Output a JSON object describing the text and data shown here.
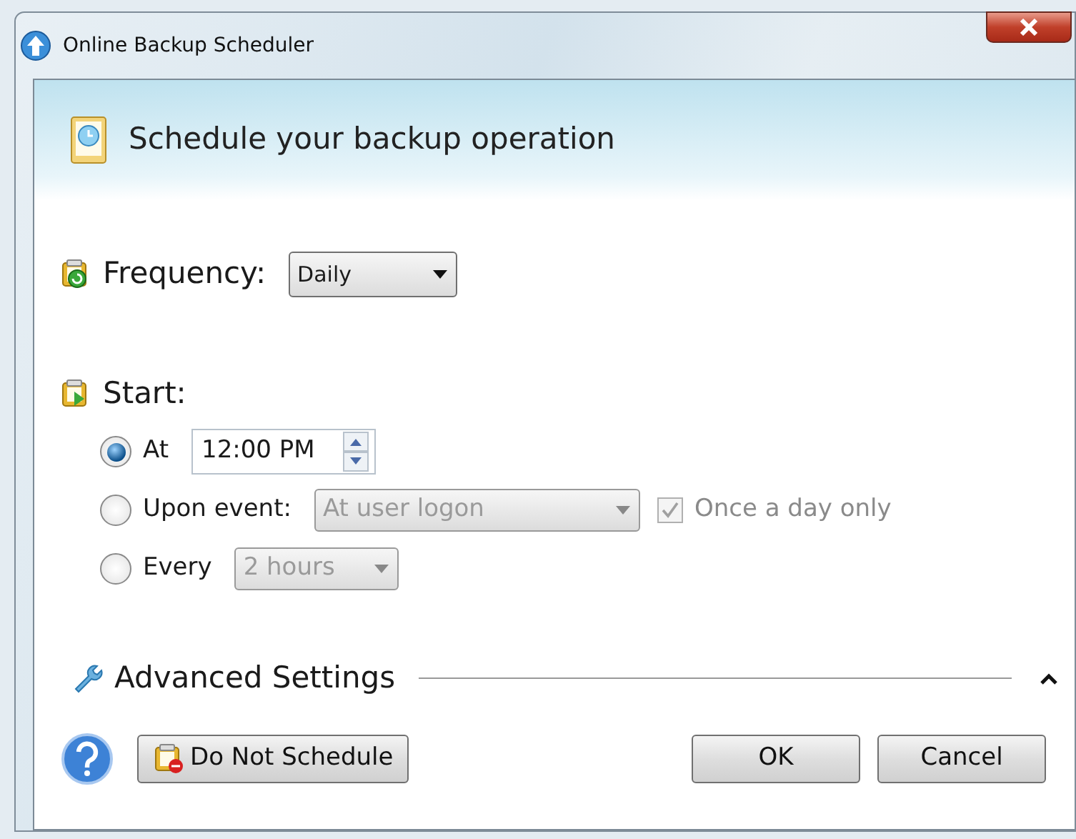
{
  "window": {
    "title": "Online Backup Scheduler"
  },
  "header": {
    "title": "Schedule your backup operation"
  },
  "frequency": {
    "label": "Frequency:",
    "value": "Daily"
  },
  "start": {
    "label": "Start:",
    "options": [
      {
        "kind": "time",
        "label": "At",
        "selected": true,
        "value": "12:00 PM"
      },
      {
        "kind": "event",
        "label": "Upon event:",
        "selected": false,
        "value": "At user logon",
        "disabled": true,
        "checkbox": {
          "label": "Once a day only",
          "checked": true,
          "disabled": true
        }
      },
      {
        "kind": "interval",
        "label": "Every",
        "selected": false,
        "value": "2 hours",
        "disabled": true
      }
    ]
  },
  "advanced": {
    "label": "Advanced Settings",
    "expanded": false
  },
  "buttons": [
    {
      "kind": "schedule-off",
      "label": "Do Not Schedule"
    },
    {
      "kind": "ok",
      "label": "OK"
    },
    {
      "kind": "cancel",
      "label": "Cancel"
    }
  ]
}
